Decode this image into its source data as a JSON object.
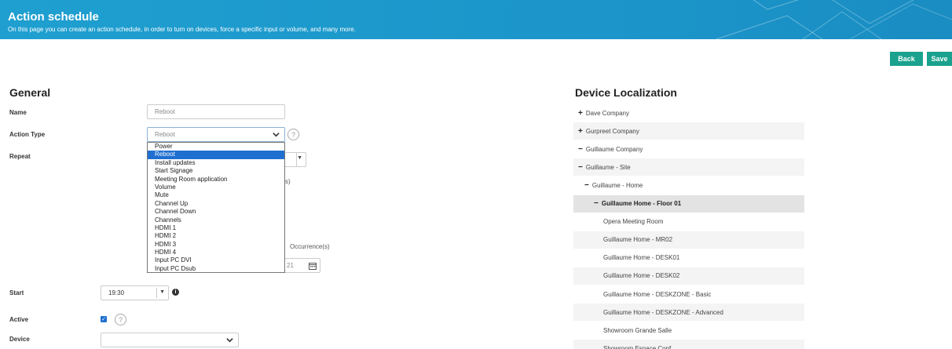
{
  "header": {
    "title": "Action schedule",
    "subtitle": "On this page you can create an action schedule, in order to turn on devices, force a specific input or volume, and many more."
  },
  "toolbar": {
    "back_label": "Back",
    "save_label": "Save"
  },
  "general": {
    "title": "General",
    "name_label": "Name",
    "name_value": "Reboot",
    "action_type_label": "Action Type",
    "action_type_value": "Reboot",
    "repeat_label": "Repeat",
    "start_label": "Start",
    "start_value": "19:30",
    "active_label": "Active",
    "device_label": "Device",
    "occurrences_partial": "Occurrence(s)",
    "date_partial": "21",
    "paren_partial": "s)"
  },
  "action_options": [
    "Power",
    "Reboot",
    "Install updates",
    "Start Signage",
    "Meeting Room application",
    "Volume",
    "Mute",
    "Channel Up",
    "Channel Down",
    "Channels",
    "HDMI 1",
    "HDMI 2",
    "HDMI 3",
    "HDMI 4",
    "Input PC DVI",
    "Input PC Dsub"
  ],
  "selected_option_index": 1,
  "localization": {
    "title": "Device Localization",
    "tree": [
      {
        "label": "Dave Company",
        "sign": "+",
        "indent": 0
      },
      {
        "label": "Gurpreet Company",
        "sign": "+",
        "indent": 0
      },
      {
        "label": "Guillaume Company",
        "sign": "−",
        "indent": 0
      },
      {
        "label": "Guillaume - Site",
        "sign": "−",
        "indent": 1
      },
      {
        "label": "Guillaume - Home",
        "sign": "−",
        "indent": 2
      },
      {
        "label": "Guillaume Home - Floor 01",
        "sign": "−",
        "indent": 3,
        "active": true
      },
      {
        "label": "Opera Meeting Room",
        "sign": "",
        "indent": 4
      },
      {
        "label": "Guillaume Home - MR02",
        "sign": "",
        "indent": 4
      },
      {
        "label": "Guillaume Home - DESK01",
        "sign": "",
        "indent": 4
      },
      {
        "label": "Guillaume Home - DESK02",
        "sign": "",
        "indent": 4
      },
      {
        "label": "Guillaume Home - DESKZONE - Basic",
        "sign": "",
        "indent": 4
      },
      {
        "label": "Guillaume Home - DESKZONE - Advanced",
        "sign": "",
        "indent": 4
      },
      {
        "label": "Showroom Grande Salle",
        "sign": "",
        "indent": 4
      },
      {
        "label": "Showroom Espace Conf",
        "sign": "",
        "indent": 4
      }
    ]
  },
  "icons": {
    "help": "question-circle-icon",
    "info": "info-circle-icon",
    "calendar": "calendar-icon",
    "chevron": "chevron-down-icon",
    "caret": "caret-down-icon",
    "check": "check-icon"
  },
  "colors": {
    "banner": "#1f9fd0",
    "button": "#1aa28e",
    "selection": "#1f6fd0"
  }
}
